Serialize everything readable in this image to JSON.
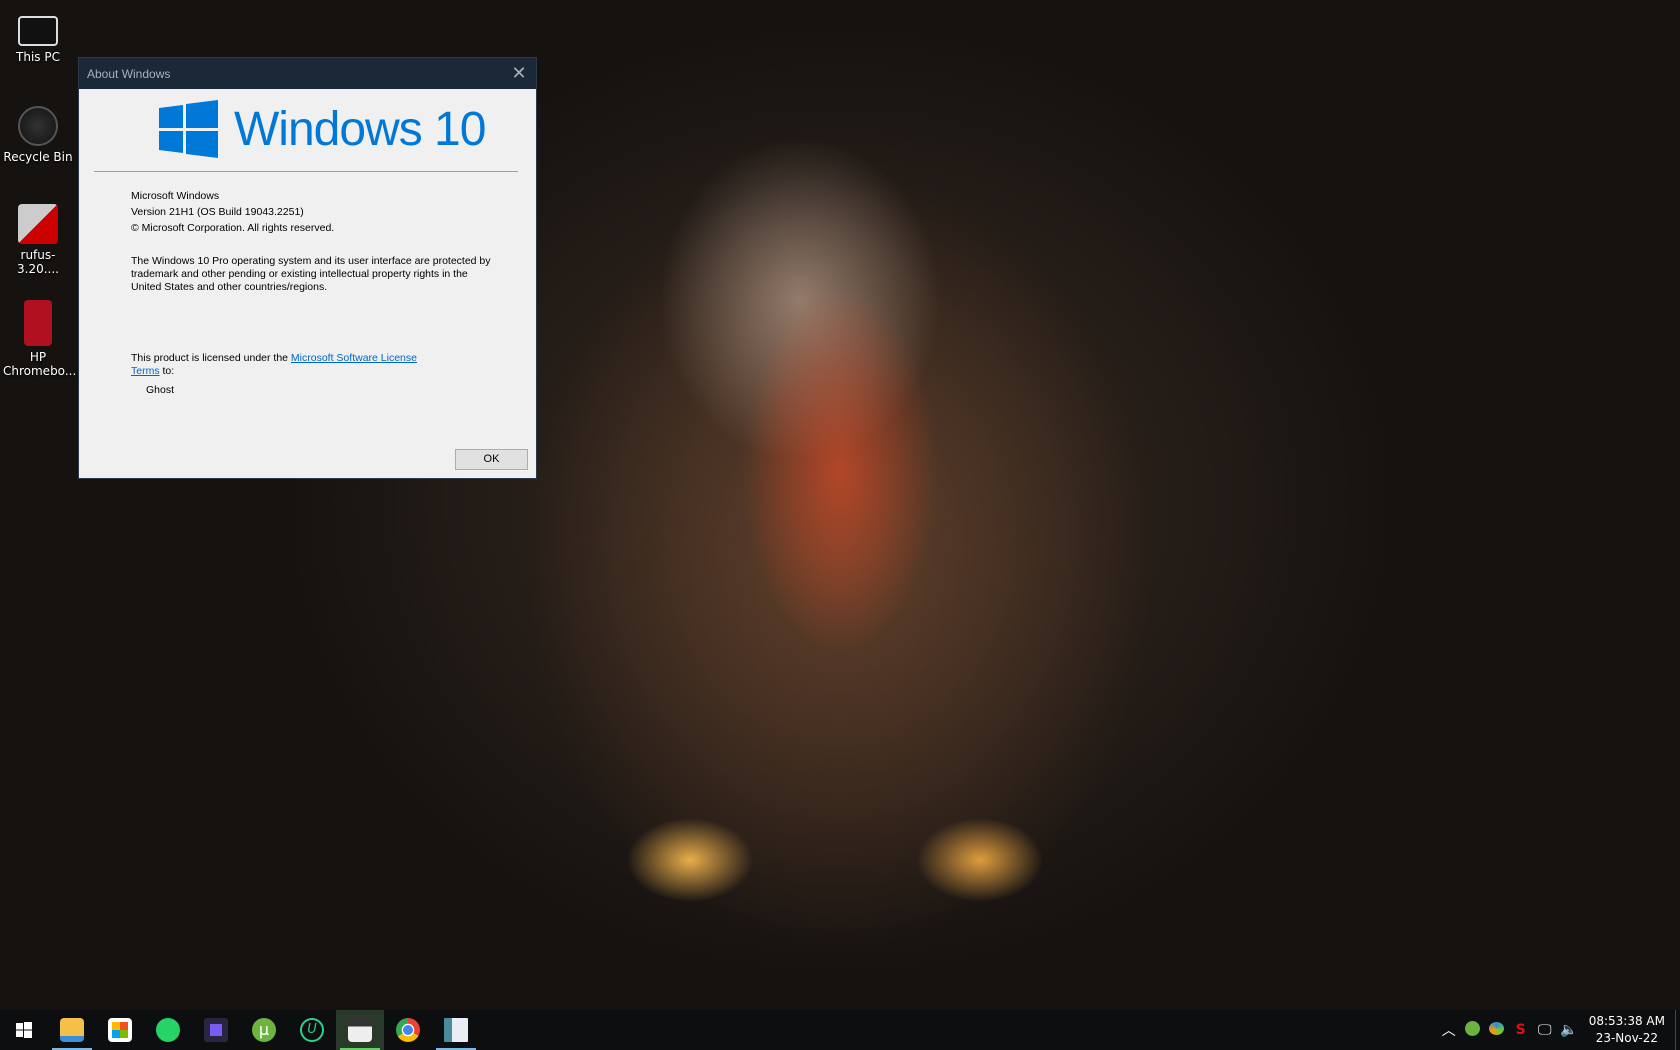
{
  "desktop": {
    "icons": [
      {
        "label": "This PC"
      },
      {
        "label": "Recycle Bin"
      },
      {
        "label": "rufus-3.20...."
      },
      {
        "label": "HP Chromebo..."
      }
    ]
  },
  "dialog": {
    "title": "About Windows",
    "logo_text": "Windows 10",
    "product": "Microsoft Windows",
    "version": "Version 21H1 (OS Build 19043.2251)",
    "copyright": "© Microsoft Corporation. All rights reserved.",
    "legal": "The Windows 10 Pro operating system and its user interface are protected by trademark and other pending or existing intellectual property rights in the United States and other countries/regions.",
    "license_prefix": "This product is licensed under the ",
    "license_link": "Microsoft Software License Terms",
    "license_suffix": " to:",
    "licensee": "Ghost",
    "ok_label": "OK",
    "accent": "#0078d7"
  },
  "taskbar": {
    "apps": [
      "start",
      "file-explorer",
      "microsoft-store",
      "whatsapp",
      "cube-app",
      "utorrent",
      "uplay",
      "video-editor",
      "chrome",
      "window-app"
    ],
    "tray": {
      "time": "08:53:38 AM",
      "date": "23-Nov-22"
    }
  }
}
